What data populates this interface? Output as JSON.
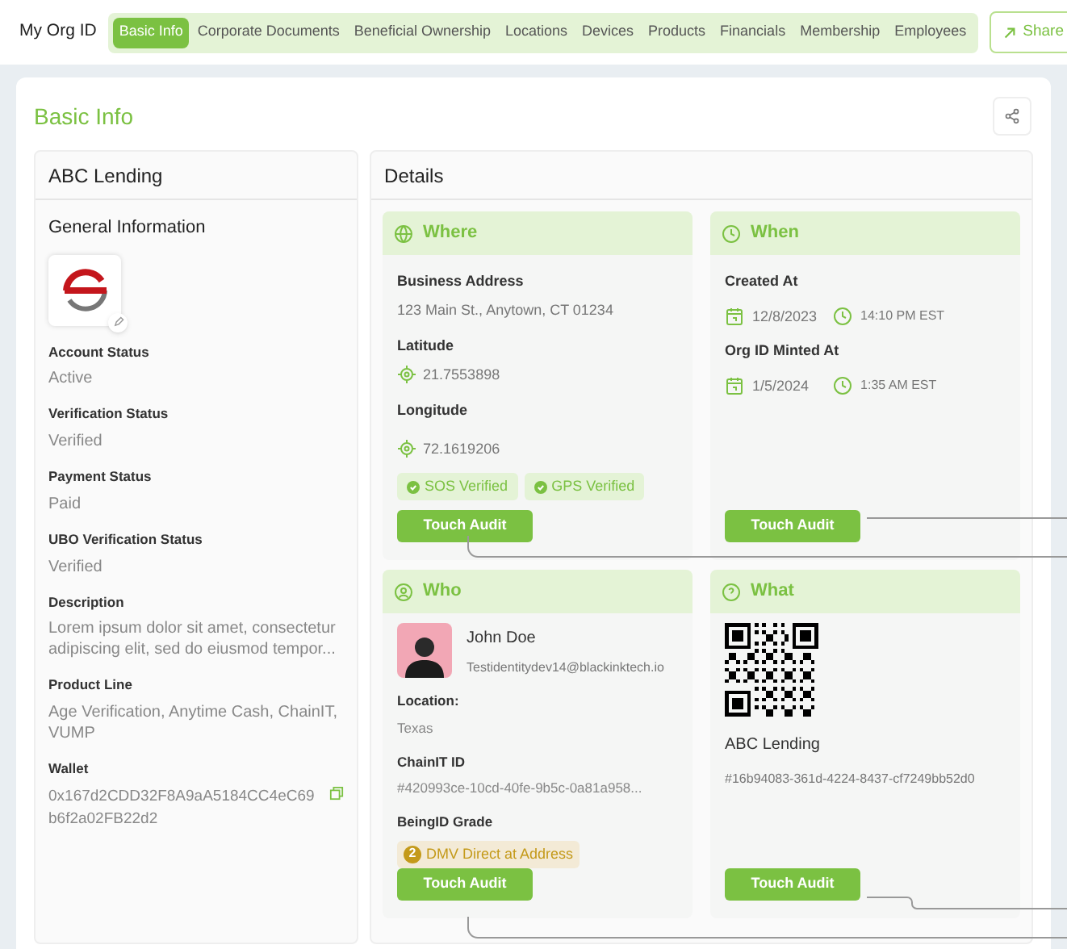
{
  "header": {
    "title": "My Org ID",
    "tabs": [
      {
        "label": "Basic Info",
        "selected": true
      },
      {
        "label": "Corporate Documents",
        "selected": false
      },
      {
        "label": "Beneficial Ownership",
        "selected": false
      },
      {
        "label": "Locations",
        "selected": false
      },
      {
        "label": "Devices",
        "selected": false
      },
      {
        "label": "Products",
        "selected": false
      },
      {
        "label": "Financials",
        "selected": false
      },
      {
        "label": "Membership",
        "selected": false
      },
      {
        "label": "Employees",
        "selected": false
      }
    ],
    "share": "Share"
  },
  "page_title": "Basic Info",
  "org": {
    "name": "ABC Lending",
    "section": "General Information",
    "fields": [
      {
        "label": "Account Status",
        "value": "Active"
      },
      {
        "label": "Verification Status",
        "value": "Verified"
      },
      {
        "label": "Payment Status",
        "value": "Paid"
      },
      {
        "label": "UBO Verification Status",
        "value": "Verified"
      },
      {
        "label": "Description",
        "value": "Lorem ipsum dolor sit amet, consectetur adipiscing elit, sed do eiusmod tempor..."
      },
      {
        "label": "Product Line",
        "value": "Age Verification, Anytime Cash, ChainIT, VUMP"
      }
    ],
    "wallet": {
      "label": "Wallet",
      "value": "0x167d2CDD32F8A9aA5184CC4eC69b6f2a02FB22d2"
    }
  },
  "details": {
    "title": "Details",
    "cards": [
      {
        "kind": "where",
        "title": "Where",
        "address_label": "Business Address",
        "address": "123 Main St., Anytown, CT 01234",
        "coords": [
          {
            "label": "Latitude",
            "value": "21.7553898"
          },
          {
            "label": "Longitude",
            "value": "72.1619206"
          }
        ],
        "badges": [
          "SOS Verified",
          "GPS Verified"
        ],
        "button": "Touch Audit"
      },
      {
        "kind": "when",
        "title": "When",
        "entries": [
          {
            "label": "Created At",
            "date": "12/8/2023",
            "time": "14:10 PM EST"
          },
          {
            "label": "Org ID Minted At",
            "date": "1/5/2024",
            "time": "1:35 AM EST"
          }
        ],
        "button": "Touch Audit"
      },
      {
        "kind": "who",
        "title": "Who",
        "name": "John Doe",
        "email": "Testidentitydev14@blackinktech.io",
        "fields": [
          {
            "label": "Location:",
            "value": "Texas"
          },
          {
            "label": "ChainIT ID",
            "value": "#420993ce-10cd-40fe-9b5c-0a81a958..."
          }
        ],
        "grade_label": "BeingID Grade",
        "grade_number": "2",
        "grade_text": "DMV Direct at Address",
        "button": "Touch Audit"
      },
      {
        "kind": "what",
        "title": "What",
        "name": "ABC Lending",
        "id": "#16b94083-361d-4224-8437-cf7249bb52d0",
        "button": "Touch Audit"
      }
    ]
  }
}
